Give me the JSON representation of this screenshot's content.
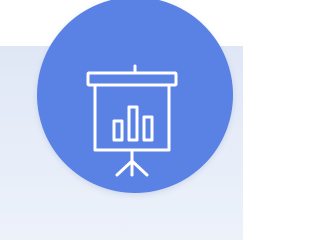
{
  "icon": {
    "name": "presentation-board-icon",
    "foreground": "#ffffff"
  },
  "colors": {
    "circle": "#5a82e4",
    "band": "#e3eaf7",
    "background": "#ffffff"
  }
}
